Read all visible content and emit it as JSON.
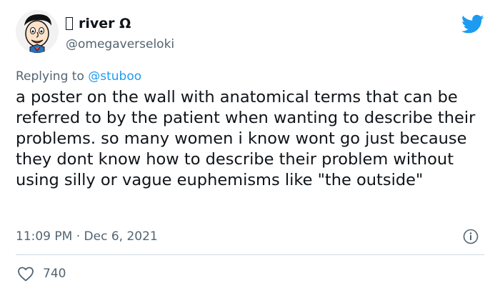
{
  "user": {
    "display_name": "river Ω",
    "handle": "@omegaverseloki",
    "avatar": "cartoon-face-avatar"
  },
  "brand": {
    "icon": "twitter-bird-icon",
    "color": "#1d9bf0"
  },
  "reply": {
    "prefix": "Replying to",
    "mention": "@stuboo"
  },
  "tweet": {
    "text": "a poster on the wall with anatomical terms that can be referred to by the patient when wanting to describe their problems. so many women i know wont go just because they dont know how to describe their problem without using silly or vague euphemisms like \"the outside\"",
    "time": "11:09 PM",
    "separator": "·",
    "date": "Dec 6, 2021"
  },
  "stats": {
    "likes": "740"
  },
  "colors": {
    "text": "#0f1419",
    "muted": "#536471",
    "divider": "#cfd9de",
    "accent": "#1d9bf0"
  }
}
